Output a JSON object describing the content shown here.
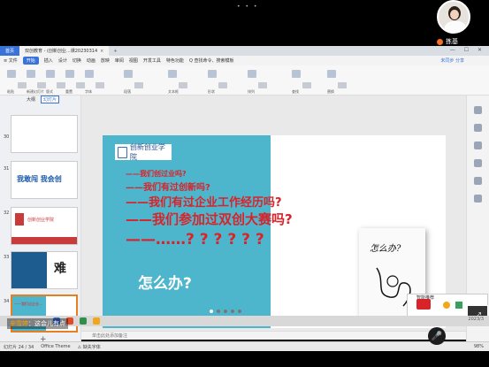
{
  "top": {
    "dots": "• • •"
  },
  "caller": {
    "name": "拣基"
  },
  "app": {
    "home_tab": "首页",
    "doc_tab": "双创教育 - (创新创业...课20230314",
    "tab_close": "×",
    "tab_add": "+",
    "window_controls": "— ☐ ✕",
    "menu": [
      "≡ 文件",
      "开始",
      "插入",
      "设计",
      "切换",
      "动画",
      "放映",
      "审阅",
      "视图",
      "开发工具",
      "特色功能",
      "Q 查找命令、搜索模板"
    ],
    "menu_share": "未同步 分享",
    "toolbar_labels": [
      "粘贴",
      "新建幻灯片",
      "版式",
      "重置",
      "字体",
      "段落",
      "文本框",
      "形状",
      "排列",
      "查找",
      "替换"
    ]
  },
  "panel": {
    "tabs": [
      "大纲",
      "幻灯片"
    ],
    "slide_numbers": [
      "30",
      "31",
      "32",
      "33",
      "34"
    ],
    "thumb_texts": [
      "",
      "我敢闯 我会创",
      "创新创业学院",
      "难",
      "——我们过企业…"
    ],
    "add_slide": "+"
  },
  "slide": {
    "logo_text": "创新创业学院",
    "lines": [
      "——我们创过业吗?",
      "——我们有过创新吗?",
      "——我们有过企业工作经历吗?",
      "——我们参加过双创大赛吗?",
      "——……? ? ? ? ? ?"
    ],
    "main_text": "怎么办?",
    "image_caption": "怎么办?"
  },
  "notes": {
    "placeholder": "单击此处添加备注"
  },
  "status": {
    "slide_info": "幻灯片 24 / 34",
    "theme": "Office Theme",
    "protect": "⚠ 缺失字体",
    "zoom": "98%"
  },
  "popup": {
    "title": "智能推荐"
  },
  "mini": {
    "icon": "⤢"
  },
  "chat": {
    "who": "辛雪婷",
    "msg": "：这会儿有点"
  },
  "bottom_time": "2023/3",
  "mic": {
    "icon": "🎤"
  }
}
